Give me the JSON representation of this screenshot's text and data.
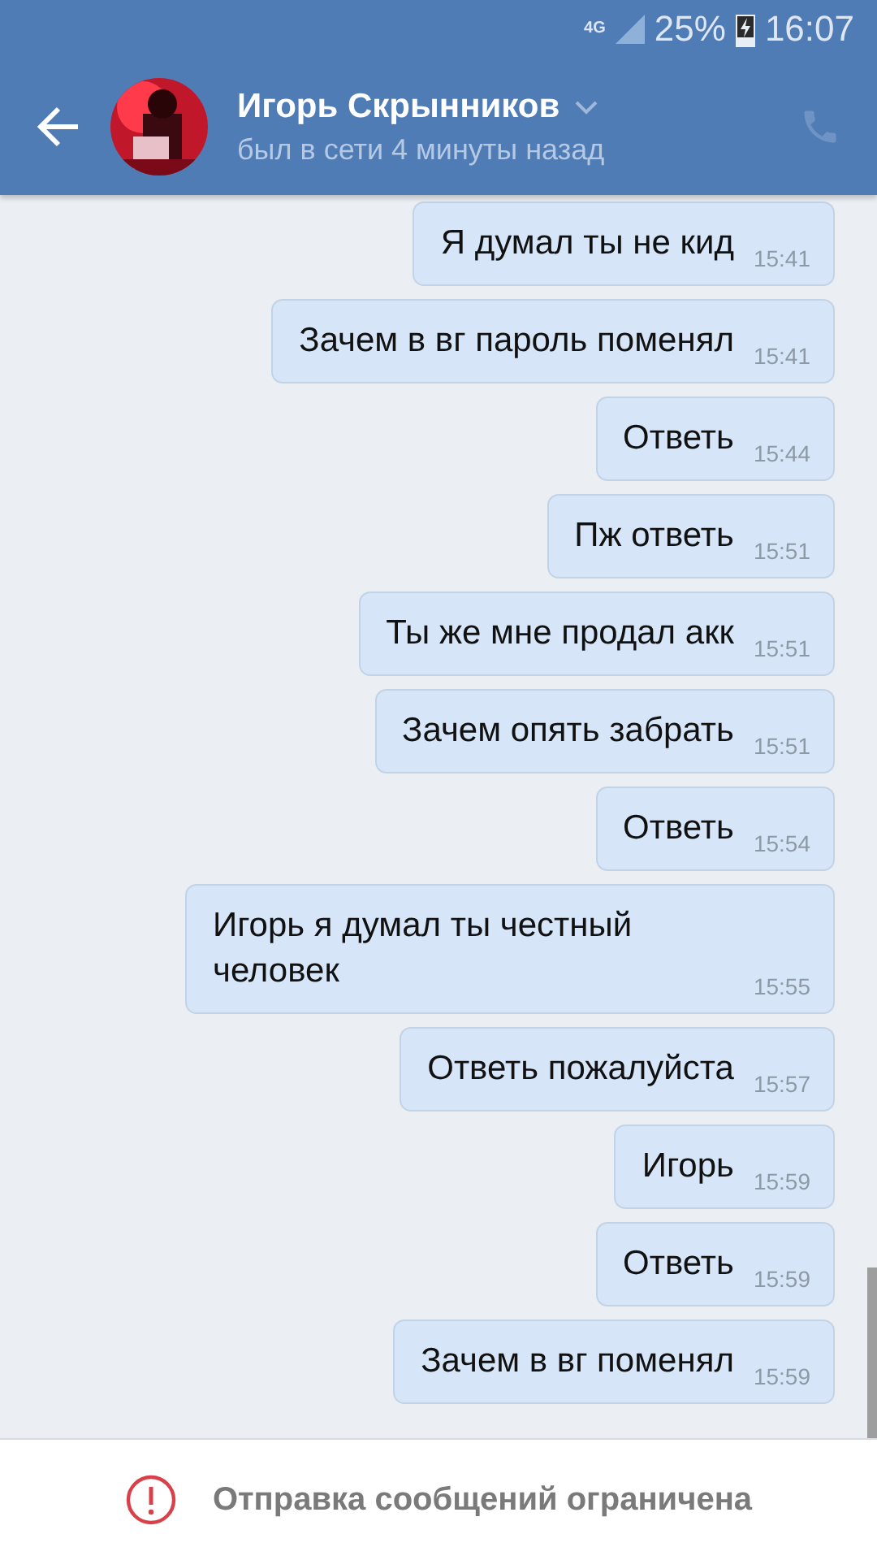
{
  "status_bar": {
    "network": "4G",
    "battery": "25%",
    "time": "16:07"
  },
  "header": {
    "name": "Игорь Скрынников",
    "status": "был в сети 4 минуты назад"
  },
  "messages": [
    {
      "text": "Я думал ты не кид",
      "time": "15:41"
    },
    {
      "text": "Зачем в вг пароль поменял",
      "time": "15:41"
    },
    {
      "text": "Ответь",
      "time": "15:44"
    },
    {
      "text": "Пж ответь",
      "time": "15:51"
    },
    {
      "text": "Ты же мне продал акк",
      "time": "15:51"
    },
    {
      "text": "Зачем опять забрать",
      "time": "15:51"
    },
    {
      "text": "Ответь",
      "time": "15:54"
    },
    {
      "text": "Игорь я думал ты честный человек",
      "time": "15:55"
    },
    {
      "text": "Ответь пожалуйста",
      "time": "15:57"
    },
    {
      "text": "Игорь",
      "time": "15:59"
    },
    {
      "text": "Ответь",
      "time": "15:59"
    },
    {
      "text": "Зачем в вг поменял",
      "time": "15:59"
    }
  ],
  "footer": {
    "notice": "Отправка сообщений ограничена"
  }
}
